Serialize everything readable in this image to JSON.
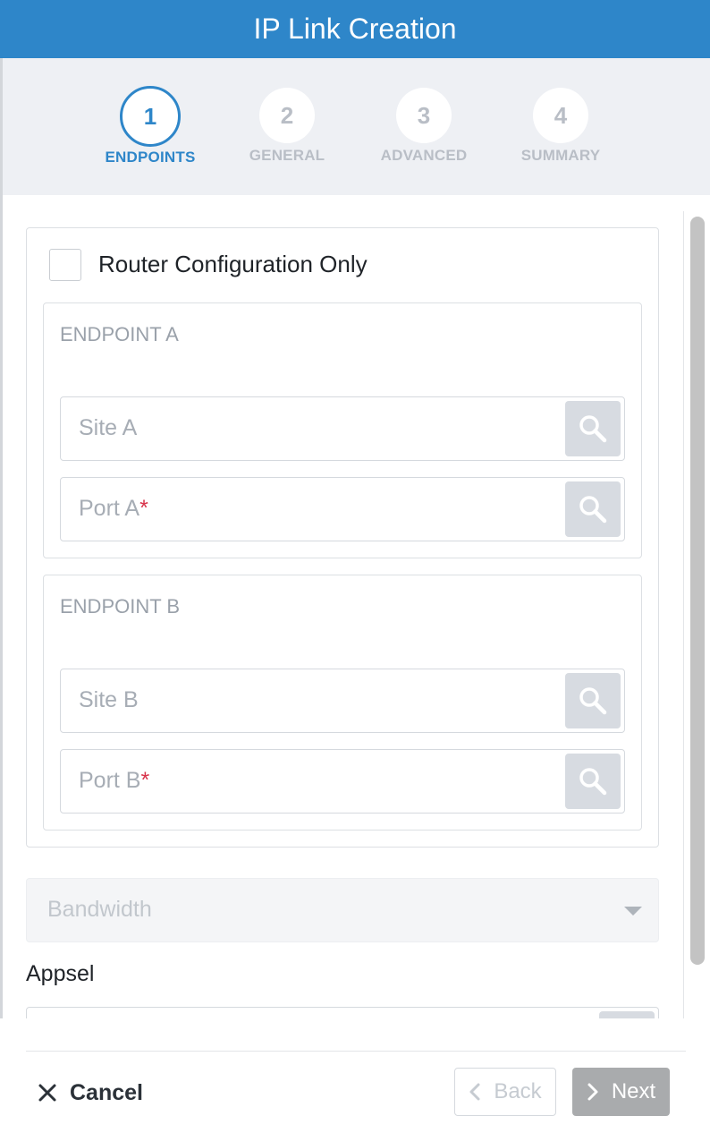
{
  "dialog": {
    "title": "IP Link Creation"
  },
  "stepper": {
    "active_step": 1,
    "steps": [
      {
        "number": "1",
        "label": "ENDPOINTS"
      },
      {
        "number": "2",
        "label": "GENERAL"
      },
      {
        "number": "3",
        "label": "ADVANCED"
      },
      {
        "number": "4",
        "label": "SUMMARY"
      }
    ]
  },
  "form": {
    "router_config_only": {
      "label": "Router Configuration Only",
      "checked": false
    },
    "endpoint_a": {
      "title": "ENDPOINT A",
      "site": {
        "placeholder": "Site A",
        "value": ""
      },
      "port": {
        "placeholder": "Port A",
        "required_mark": "*",
        "value": ""
      }
    },
    "endpoint_b": {
      "title": "ENDPOINT B",
      "site": {
        "placeholder": "Site B",
        "value": ""
      },
      "port": {
        "placeholder": "Port B",
        "required_mark": "*",
        "value": ""
      }
    },
    "bandwidth": {
      "placeholder": "Bandwidth",
      "value": ""
    },
    "appsel": {
      "label": "Appsel",
      "value": ""
    }
  },
  "footer": {
    "cancel_label": "Cancel",
    "back_label": "Back",
    "next_label": "Next"
  },
  "icons": {
    "search": "search-icon",
    "close": "close-icon",
    "chevron_left": "chevron-left-icon",
    "chevron_right": "chevron-right-icon",
    "caret_down": "caret-down-icon"
  },
  "colors": {
    "header": "#2e86c9",
    "accent": "#2e86c9",
    "stepper_bg": "#eef0f4",
    "required": "#d8334a",
    "next_button": "#a9abad"
  }
}
